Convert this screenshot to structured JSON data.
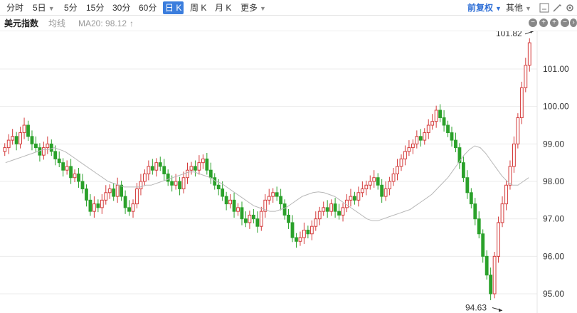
{
  "toolbar": {
    "tabs": [
      {
        "label": "分时",
        "dropdown": false
      },
      {
        "label": "5日",
        "dropdown": true
      },
      {
        "label": "5分",
        "dropdown": false
      },
      {
        "label": "15分",
        "dropdown": false
      },
      {
        "label": "30分",
        "dropdown": false
      },
      {
        "label": "60分",
        "dropdown": false
      },
      {
        "label": "日 K",
        "dropdown": false,
        "active": true
      },
      {
        "label": "周 K",
        "dropdown": false
      },
      {
        "label": "月 K",
        "dropdown": false
      },
      {
        "label": "更多",
        "dropdown": true
      }
    ],
    "adjust_label": "前复权",
    "other_label": "其他"
  },
  "info": {
    "title": "美元指数",
    "avg_label": "均线",
    "ma_label": "MA20: 98.12",
    "ma_arrow": "↑"
  },
  "colors": {
    "up": "#d43a3a",
    "down": "#2aa12a",
    "ma": "#b8b8b8",
    "grid": "#ebebeb",
    "accent": "#3b7ddd"
  },
  "chart_data": {
    "type": "candlestick",
    "y_ticks": [
      95.0,
      96.0,
      97.0,
      98.0,
      99.0,
      100.0,
      101.0
    ],
    "ylim": [
      94.63,
      101.82
    ],
    "max_label": "101.82",
    "min_label": "94.63",
    "candles_close": [
      98.9,
      99.1,
      99.2,
      99.0,
      99.3,
      99.5,
      99.2,
      99.0,
      98.9,
      98.7,
      98.9,
      99.0,
      98.8,
      98.6,
      98.5,
      98.3,
      98.4,
      98.1,
      98.2,
      98.0,
      97.8,
      97.5,
      97.2,
      97.4,
      97.3,
      97.5,
      97.7,
      97.8,
      97.6,
      97.9,
      97.6,
      97.3,
      97.2,
      97.4,
      97.8,
      98.0,
      98.2,
      98.4,
      98.3,
      98.5,
      98.4,
      98.2,
      98.0,
      97.9,
      98.0,
      97.8,
      98.1,
      98.3,
      98.4,
      98.3,
      98.5,
      98.6,
      98.3,
      98.1,
      97.9,
      97.8,
      97.6,
      97.4,
      97.5,
      97.2,
      97.3,
      97.0,
      96.9,
      97.1,
      97.0,
      96.8,
      97.2,
      97.5,
      97.6,
      97.7,
      97.6,
      97.4,
      97.1,
      96.9,
      96.5,
      96.4,
      96.5,
      96.7,
      96.6,
      96.8,
      97.0,
      97.2,
      97.3,
      97.2,
      97.4,
      97.2,
      97.1,
      97.3,
      97.5,
      97.6,
      97.5,
      97.7,
      97.8,
      97.9,
      98.0,
      98.1,
      97.9,
      97.6,
      97.8,
      98.0,
      98.2,
      98.4,
      98.6,
      98.8,
      98.9,
      99.0,
      99.2,
      99.1,
      99.3,
      99.5,
      99.6,
      99.9,
      99.7,
      99.5,
      99.3,
      99.1,
      98.9,
      98.5,
      98.1,
      97.7,
      97.4,
      97.0,
      96.6,
      96.0,
      95.5,
      95.0,
      96.0,
      96.9,
      97.4,
      97.9,
      98.4,
      99.0,
      99.7,
      100.5,
      101.1,
      101.7
    ],
    "ma20": [
      98.5,
      98.55,
      98.6,
      98.65,
      98.7,
      98.75,
      98.8,
      98.85,
      98.85,
      98.9,
      98.85,
      98.8,
      98.7,
      98.6,
      98.5,
      98.4,
      98.3,
      98.2,
      98.1,
      98.0,
      97.95,
      97.9,
      97.85,
      97.85,
      97.85,
      97.85,
      97.9,
      97.9,
      97.95,
      98.0,
      98.05,
      98.1,
      98.15,
      98.2,
      98.25,
      98.25,
      98.2,
      98.15,
      98.1,
      98.0,
      97.95,
      97.85,
      97.75,
      97.65,
      97.55,
      97.45,
      97.35,
      97.3,
      97.25,
      97.2,
      97.2,
      97.25,
      97.3,
      97.4,
      97.5,
      97.6,
      97.65,
      97.7,
      97.72,
      97.7,
      97.65,
      97.6,
      97.5,
      97.4,
      97.3,
      97.2,
      97.1,
      97.0,
      96.95,
      96.95,
      97.0,
      97.05,
      97.1,
      97.15,
      97.2,
      97.25,
      97.35,
      97.45,
      97.55,
      97.65,
      97.8,
      97.95,
      98.1,
      98.3,
      98.5,
      98.7,
      98.85,
      98.95,
      98.9,
      98.75,
      98.55,
      98.35,
      98.15,
      98.0,
      97.9,
      97.9,
      98.0,
      98.1
    ]
  }
}
